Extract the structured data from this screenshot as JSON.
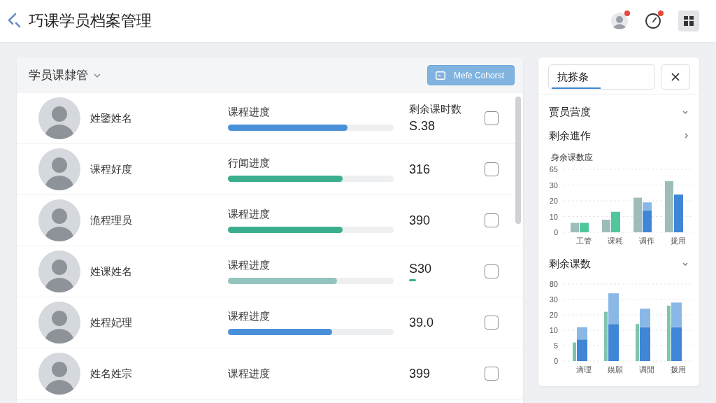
{
  "header": {
    "title": "巧课学员档案管理",
    "actions": [
      {
        "kind": "avatar",
        "badge": true
      },
      {
        "kind": "gauge",
        "badge": true
      },
      {
        "kind": "grid",
        "badge": false
      }
    ]
  },
  "student_panel": {
    "title": "学员课隸管",
    "button": "Mefe Cohorst",
    "rows": [
      {
        "name": "姓鑒姓名",
        "progress_label": "课程进度",
        "level": 0.72,
        "color": "#4a90d9",
        "remaining_label": "剩余课时数",
        "remaining": "S.38",
        "indicator": false,
        "checked": false
      },
      {
        "name": "课程好度",
        "progress_label": "行闻进度",
        "level": 0.69,
        "color": "#3bae8e",
        "remaining": "316",
        "indicator": false,
        "checked": false
      },
      {
        "name": "洈程理员",
        "progress_label": "课程进度",
        "level": 0.69,
        "color": "#3bae8e",
        "remaining": "390",
        "indicator": false,
        "checked": false
      },
      {
        "name": "姓课姓名",
        "progress_label": "课程进度",
        "level": 0.66,
        "color": "#93c4bd",
        "remaining": "S30",
        "indicator": true,
        "checked": false
      },
      {
        "name": "姓程妃理",
        "progress_label": "课程进度",
        "level": 0.63,
        "color": "#4a90d9",
        "remaining": "39.0",
        "indicator": false,
        "checked": false
      },
      {
        "name": "姓名姓宗",
        "progress_label": "课程进度",
        "remaining": "399",
        "indicator": false,
        "checked": false
      }
    ]
  },
  "side_panel": {
    "search": {
      "value": "抗搽条"
    },
    "sections": [
      {
        "label": "贾员营度",
        "expanded": true
      },
      {
        "label": "剩余進作",
        "expanded": false
      }
    ],
    "overview_chart": {
      "title": "身余课数应",
      "axis_labels": [
        "65",
        "30",
        "20",
        "10",
        "0"
      ],
      "categories": [
        "工管",
        "课耗",
        "调作",
        "拢用"
      ]
    },
    "remaining_section": {
      "label": "剩余课数",
      "expanded": true,
      "axis_labels": [
        "80",
        "30",
        "20",
        "10",
        "5",
        "0"
      ],
      "categories": [
        "滴理",
        "娱願",
        "调閒",
        "拨用"
      ]
    }
  }
}
